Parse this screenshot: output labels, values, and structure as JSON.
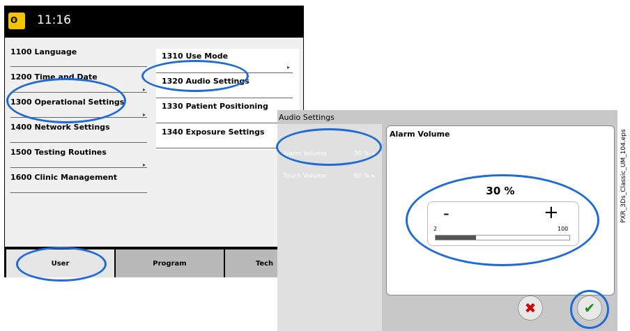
{
  "topbar": {
    "clock": "11:16",
    "app_icon_text": "ʘ",
    "app_icon": "operator-icon"
  },
  "menu": {
    "items": [
      {
        "label": "1100  Language"
      },
      {
        "label": "1200  Time and Date"
      },
      {
        "label": "1300  Operational Settings"
      },
      {
        "label": "1400  Network Settings"
      },
      {
        "label": "1500  Testing Routines"
      },
      {
        "label": "1600  Clinic Management"
      }
    ]
  },
  "submenu": {
    "items": [
      {
        "label": "1310  Use Mode"
      },
      {
        "label": "1320  Audio Settings"
      },
      {
        "label": "1330  Patient Positioning"
      },
      {
        "label": "1340  Exposure Settings"
      }
    ]
  },
  "tabs": [
    {
      "label": "User"
    },
    {
      "label": "Program"
    },
    {
      "label": "Tech"
    }
  ],
  "audio": {
    "title": "Audio Settings",
    "rows": [
      {
        "label": "Alarm Volume",
        "value": "30 % ◂"
      },
      {
        "label": "Touch Volume",
        "value": "60 % ▸"
      }
    ],
    "detail": {
      "title": "Alarm Volume",
      "value": "30 %",
      "minus": "-",
      "plus": "+",
      "min_label": "2",
      "max_label": "100",
      "level_percent": 30
    },
    "cancel_glyph": "✖",
    "ok_glyph": "✔"
  },
  "side_label": "PXR_3Ds_Classic_UM_104.eps",
  "colors": {
    "highlight": "#1e6ad8",
    "accent": "#f3c400"
  }
}
